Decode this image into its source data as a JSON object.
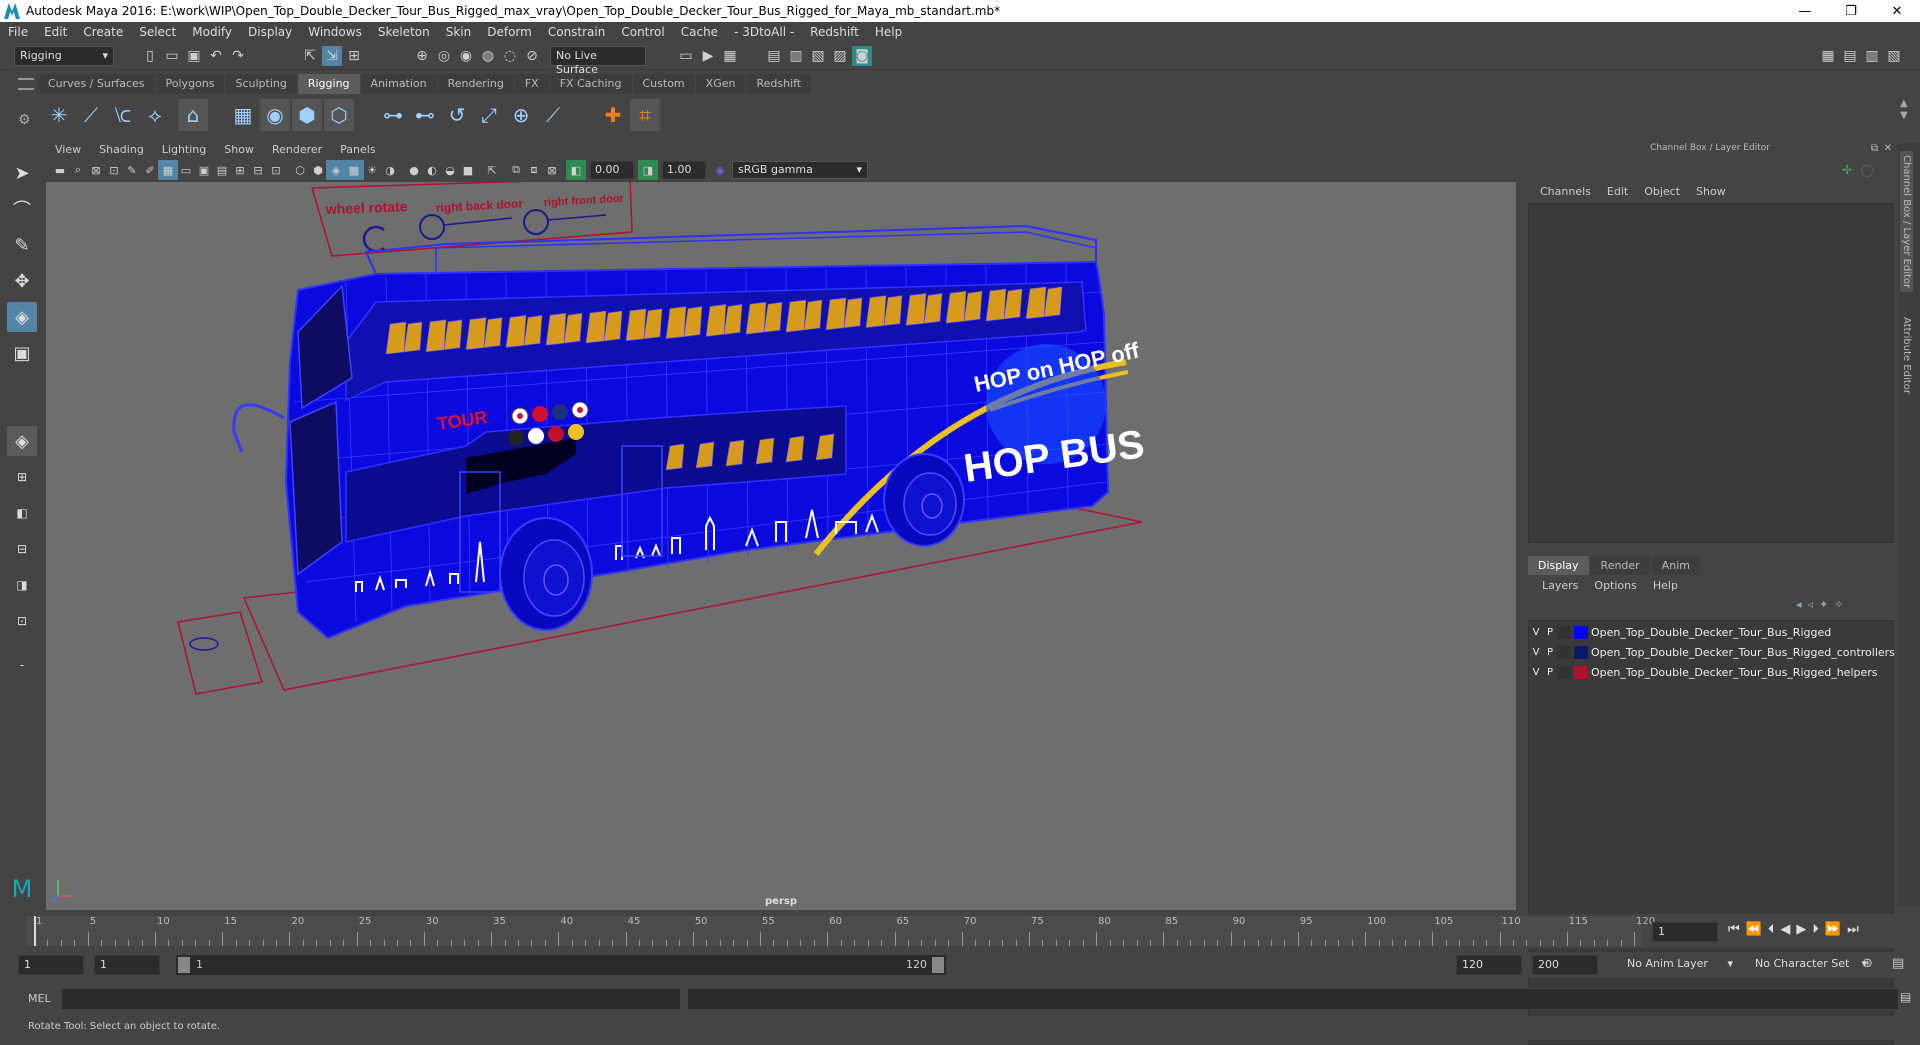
{
  "window": {
    "title": "Autodesk Maya 2016: E:\\work\\WIP\\Open_Top_Double_Decker_Tour_Bus_Rigged_max_vray\\Open_Top_Double_Decker_Tour_Bus_Rigged_for_Maya_mb_standart.mb*",
    "minimize": "—",
    "restore": "❐",
    "close": "✕"
  },
  "menubar": [
    "File",
    "Edit",
    "Create",
    "Select",
    "Modify",
    "Display",
    "Windows",
    "Skeleton",
    "Skin",
    "Deform",
    "Constrain",
    "Control",
    "Cache",
    "- 3DtoAll -",
    "Redshift",
    "Help"
  ],
  "statusline": {
    "mode": "Rigging",
    "live_surface": "No Live Surface"
  },
  "shelf": {
    "tabs": [
      "Curves / Surfaces",
      "Polygons",
      "Sculpting",
      "Rigging",
      "Animation",
      "Rendering",
      "FX",
      "FX Caching",
      "Custom",
      "XGen",
      "Redshift"
    ],
    "active_tab": "Rigging"
  },
  "panel": {
    "menu": [
      "View",
      "Shading",
      "Lighting",
      "Show",
      "Renderer",
      "Panels"
    ],
    "exposure": "0.00",
    "gamma": "1.00",
    "color_space": "sRGB gamma",
    "camera_label": "persp"
  },
  "viewport": {
    "controls_panel": {
      "wheel_rotate": "wheel rotate",
      "right_back_door": "right back door",
      "right_front_door": "right front door"
    },
    "bus_text": {
      "hop_on_hop_off": "HOP on HOP off",
      "tour": "TOUR",
      "hop_bus": "HOP BUS"
    },
    "wire_color": "#1414ff",
    "seat_color": "#e0a21a",
    "background": "#6e6e6e"
  },
  "channel_box": {
    "title": "Channel Box / Layer Editor",
    "menu": [
      "Channels",
      "Edit",
      "Object",
      "Show"
    ]
  },
  "layer_editor": {
    "tabs": [
      "Display",
      "Render",
      "Anim"
    ],
    "active_tab": "Display",
    "menu": [
      "Layers",
      "Options",
      "Help"
    ],
    "layers": [
      {
        "v": "V",
        "p": "P",
        "name": "Open_Top_Double_Decker_Tour_Bus_Rigged",
        "color": "#0000ff"
      },
      {
        "v": "V",
        "p": "P",
        "name": "Open_Top_Double_Decker_Tour_Bus_Rigged_controllers",
        "color": "#0a1a6a"
      },
      {
        "v": "V",
        "p": "P",
        "name": "Open_Top_Double_Decker_Tour_Bus_Rigged_helpers",
        "color": "#b0102a"
      }
    ]
  },
  "side_tabs": [
    "Channel Box / Layer Editor",
    "Attribute Editor"
  ],
  "time_slider": {
    "labels": [
      "1",
      "5",
      "10",
      "15",
      "20",
      "25",
      "30",
      "35",
      "40",
      "45",
      "50",
      "55",
      "60",
      "65",
      "70",
      "75",
      "80",
      "85",
      "90",
      "95",
      "100",
      "105",
      "110",
      "115",
      "120"
    ],
    "current_frame": "1"
  },
  "range": {
    "start": "1",
    "playback_start": "1",
    "slider_left": "1",
    "slider_right": "120",
    "playback_end": "120",
    "end": "200",
    "anim_layer": "No Anim Layer",
    "character_set": "No Character Set"
  },
  "mel": {
    "label": "MEL"
  },
  "help_line": "Rotate Tool: Select an object to rotate."
}
